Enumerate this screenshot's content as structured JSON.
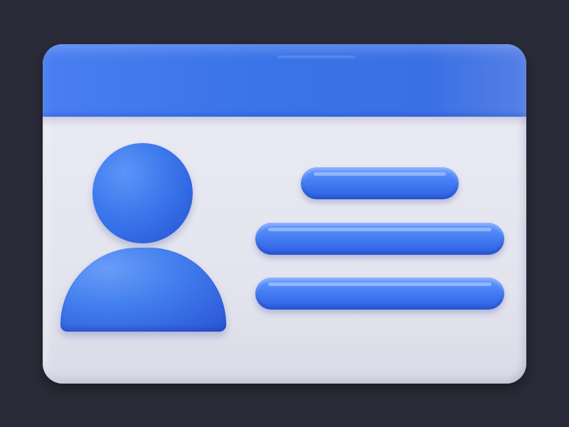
{
  "page": {
    "background_color": "#2a2b38"
  },
  "id_card": {
    "icon": "id-card-icon",
    "header_color": "#3b74e8",
    "body_color": "#e6e6f1",
    "avatar": {
      "icon": "user-avatar-icon",
      "color": "#3b77ec"
    },
    "info_lines": [
      {
        "icon": "text-line-placeholder"
      },
      {
        "icon": "text-line-placeholder"
      },
      {
        "icon": "text-line-placeholder"
      }
    ]
  }
}
